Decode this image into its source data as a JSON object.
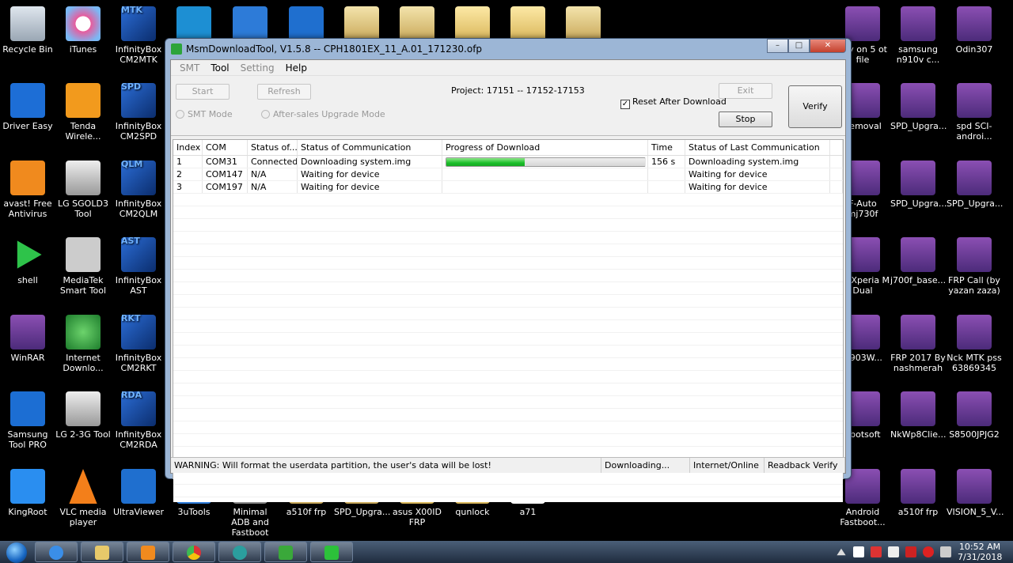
{
  "desktop": {
    "col1": [
      "Recycle Bin",
      "Driver Easy",
      "avast! Free Antivirus",
      "shell",
      "WinRAR",
      "Samsung Tool PRO",
      "KingRoot"
    ],
    "col2": [
      "iTunes",
      "Tenda Wirele...",
      "LG SGOLD3 Tool",
      "MediaTek Smart Tool",
      "Internet Downlo...",
      "LG 2-3G Tool",
      "VLC media player"
    ],
    "col3": [
      "InfinityBox CM2MTK",
      "InfinityBox CM2SPD",
      "InfinityBox CM2QLM",
      "InfinityBox AST",
      "InfinityBox CM2RKT",
      "InfinityBox CM2RDA",
      "UltraViewer"
    ],
    "col3_tags": [
      "MTK",
      "SPD",
      "QLM",
      "AST",
      "RKT",
      "RDA"
    ],
    "bottom_row": [
      "3uTools",
      "Minimal ADB and Fastboot",
      "a510f frp",
      "SPD_Upgra...",
      "asus X00ID FRP",
      "qunlock",
      "a71"
    ],
    "right_col1": [
      "axy on 5 ot file",
      "Removal",
      "F-Auto mj730f",
      "05_Xperia M Dual",
      "G903W...",
      "obotsoft",
      "Android Fastboot..."
    ],
    "right_col2": [
      "samsung n910v c...",
      "SPD_Upgra...",
      "SPD_Upgra...",
      "j700f_base...",
      "FRP 2017 By nashmerah",
      "NkWp8Clie...",
      "a510f frp"
    ],
    "right_col3": [
      "Odin307",
      "spd SCI-androi...",
      "SPD_Upgra...",
      "FRP Call (by yazan zaza)",
      "Nck MTK pss 63869345",
      "S8500JPJG2",
      "VISION_5_V..."
    ]
  },
  "window": {
    "title": "MsmDownloadTool, V1.5.8 -- CPH1801EX_11_A.01_171230.ofp",
    "minimize": "–",
    "maximize": "□",
    "close": "✕",
    "menu": [
      "SMT",
      "Tool",
      "Setting",
      "Help"
    ],
    "buttons": {
      "start": "Start",
      "refresh": "Refresh",
      "exit": "Exit",
      "stop": "Stop",
      "verify": "Verify"
    },
    "project": "Project: 17151 -- 17152-17153",
    "radios": {
      "smt": "SMT Mode",
      "aftersales": "After-sales Upgrade Mode"
    },
    "reset_label": "Reset After Download",
    "reset_checked": "✓",
    "columns": [
      "Index",
      "COM",
      "Status of...",
      "Status of Communication",
      "Progress of Download",
      "Time",
      "Status of Last Communication"
    ],
    "rows": [
      {
        "index": "1",
        "com": "COM31",
        "status": "Connected",
        "comm": "Downloading system.img",
        "progress": 0.4,
        "time": "156 s",
        "last": "Downloading system.img"
      },
      {
        "index": "2",
        "com": "COM147",
        "status": "N/A",
        "comm": "Waiting for device",
        "progress": null,
        "time": "",
        "last": "Waiting for device"
      },
      {
        "index": "3",
        "com": "COM197",
        "status": "N/A",
        "comm": "Waiting for device",
        "progress": null,
        "time": "",
        "last": "Waiting for device"
      }
    ],
    "statusbar": [
      "WARNING: Will format the userdata partition, the user's data will be lost!",
      "Downloading...",
      "Internet/Online",
      "Readback Verify"
    ]
  },
  "taskbar": {
    "time": "10:52 AM",
    "date": "7/31/2018"
  },
  "colors": {
    "progress": "#1bbf2a",
    "desktop": "#000000",
    "taskbar": "#2b3a50"
  }
}
